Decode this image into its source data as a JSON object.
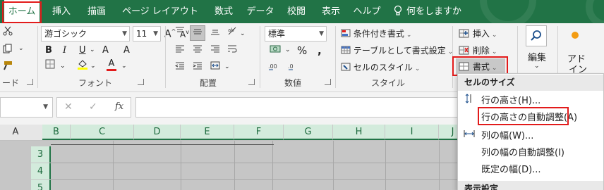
{
  "tabs": [
    {
      "label": "ホーム",
      "active": true
    },
    {
      "label": "挿入"
    },
    {
      "label": "描画"
    },
    {
      "label": "ページ レイアウト"
    },
    {
      "label": "数式"
    },
    {
      "label": "データ"
    },
    {
      "label": "校閲"
    },
    {
      "label": "表示"
    },
    {
      "label": "ヘルプ"
    }
  ],
  "tell_me": "何をしますか",
  "ribbon": {
    "clipboard_label": "ード",
    "font": {
      "name": "游ゴシック",
      "size": "11",
      "bold": "B",
      "italic": "I",
      "underline": "U",
      "grow": "A",
      "shrink": "A",
      "fill_letter": "A",
      "label": "フォント"
    },
    "alignment_label": "配置",
    "number": {
      "format": "標準",
      "percent": "%",
      "label": "数値"
    },
    "styles": {
      "conditional": "条件付き書式",
      "table": "テーブルとして書式設定",
      "cell_styles": "セルのスタイル",
      "label": "スタイル"
    },
    "cells": {
      "insert": "挿入",
      "delete": "削除",
      "format": "書式"
    },
    "editing_label": "編集",
    "addin_label1": "アド",
    "addin_label2": "イン"
  },
  "formula_bar": {
    "fx": "fx"
  },
  "columns": [
    "A",
    "B",
    "C",
    "D",
    "E",
    "F",
    "G",
    "H",
    "I",
    "J"
  ],
  "rows": [
    "3",
    "4",
    "5"
  ],
  "format_menu": {
    "section1": "セルのサイズ",
    "row_height": "行の高さ(H)...",
    "autofit_row": "行の高さの自動調整(A)",
    "col_width": "列の幅(W)...",
    "autofit_col": "列の幅の自動調整(I)",
    "default_width": "既定の幅(D)...",
    "section2": "表示設定"
  },
  "colors": {
    "accent": "#217346",
    "highlight": "#e21b1b",
    "fill_bar": "#ffff00",
    "font_bar": "#e21b1b"
  }
}
